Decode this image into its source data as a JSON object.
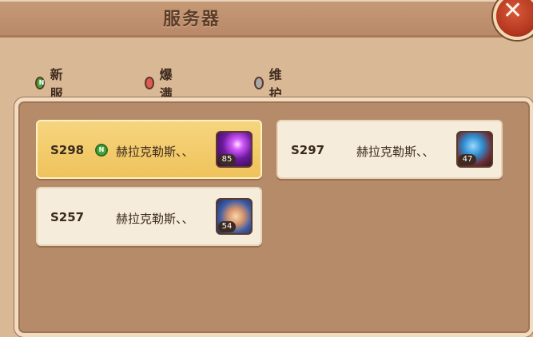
{
  "header": {
    "title": "服务器",
    "close_label": "✕"
  },
  "legend": [
    {
      "label": "新服",
      "status": "new"
    },
    {
      "label": "爆满",
      "status": "full"
    },
    {
      "label": "维护",
      "status": "maintenance"
    }
  ],
  "servers": [
    {
      "code": "S298",
      "name": "赫拉克勒斯、、",
      "level": "85",
      "status": "new",
      "selected": true
    },
    {
      "code": "S297",
      "name": "赫拉克勒斯、、",
      "level": "47",
      "status": "normal",
      "selected": false
    },
    {
      "code": "S257",
      "name": "赫拉克勒斯、、",
      "level": "54",
      "status": "normal",
      "selected": false
    }
  ],
  "colors": {
    "new": "#47a63a",
    "full": "#e25a4e",
    "maintenance": "#a8a8a8",
    "selected_card": "#efc25b",
    "card": "#f5ecdc",
    "panel": "#b58b69"
  }
}
